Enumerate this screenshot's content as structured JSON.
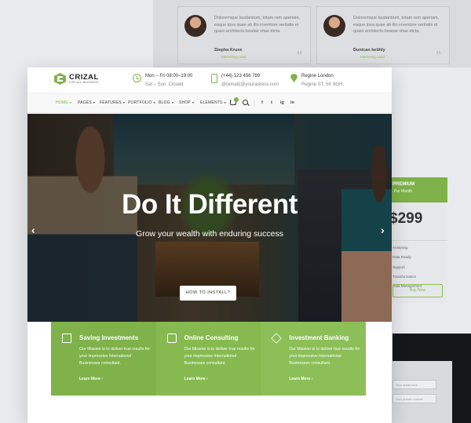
{
  "testimonials": [
    {
      "text": "Doloremque laudantium, totam rem aperiam, eaque ipsa quae ab illo inventore veritatis et quasi architecto beatae vitae dicta.",
      "name": "Stepha Kruse",
      "role": "Marketing Lead"
    },
    {
      "text": "Doloremque laudantium, totam rem aperiam, eaque ipsa quae ab illo inventore veritatis et quasi architecto beatae vitae dicta.",
      "name": "Dunican keithly",
      "role": "Marketing Lead"
    }
  ],
  "pricing": {
    "plan": "PREMIUM",
    "period": "Per Month",
    "price": "$299",
    "features": [
      "Analysing",
      "Data Ready",
      "Support",
      "Transformation",
      "Data Management"
    ],
    "buy": "Buy Now"
  },
  "form": {
    "placeholders": [
      "Your email here",
      "Your phone number"
    ]
  },
  "brand": {
    "name": "CRIZAL",
    "tagline": "FOR ALL BUSINESS",
    "accent": "#7fb24a"
  },
  "contact": {
    "hours_l1": "Mon – Fri 08:00–19:00",
    "hours_l2": "Sat – Sun: Closed",
    "phone": "(+44) 123 456 789",
    "email": "@(email)@youradress.com",
    "loc_l1": "Regine London",
    "loc_l2": "Regine ST, 5K 8GH,"
  },
  "nav": {
    "items": [
      "HOME",
      "PAGES",
      "FEATURES",
      "PORTFOLIO",
      "BLOG",
      "SHOP",
      "ELEMENTS"
    ],
    "social": [
      "f",
      "t",
      "ig",
      "in"
    ]
  },
  "hero": {
    "title": "Do It Different",
    "subtitle": "Grow your wealth with enduring success",
    "button": "HOW TO INSTALL?",
    "prev": "‹",
    "next": "›"
  },
  "features": [
    {
      "icon": "tools-icon",
      "title": "Saving Investments",
      "desc": "Our Mission is to deliver true results for your impressive International Businesses consultant.",
      "link": "Learn More ›"
    },
    {
      "icon": "diamond-icon",
      "title": "Online Consulting",
      "desc": "Our Mission is to deliver true results for your impressive International Businesses consultant.",
      "link": "Learn More ›"
    },
    {
      "icon": "layers-icon",
      "title": "Investment Banking",
      "desc": "Our Mission is to deliver true results for your impressive International Businesses consultant.",
      "link": "Learn More ›"
    }
  ]
}
